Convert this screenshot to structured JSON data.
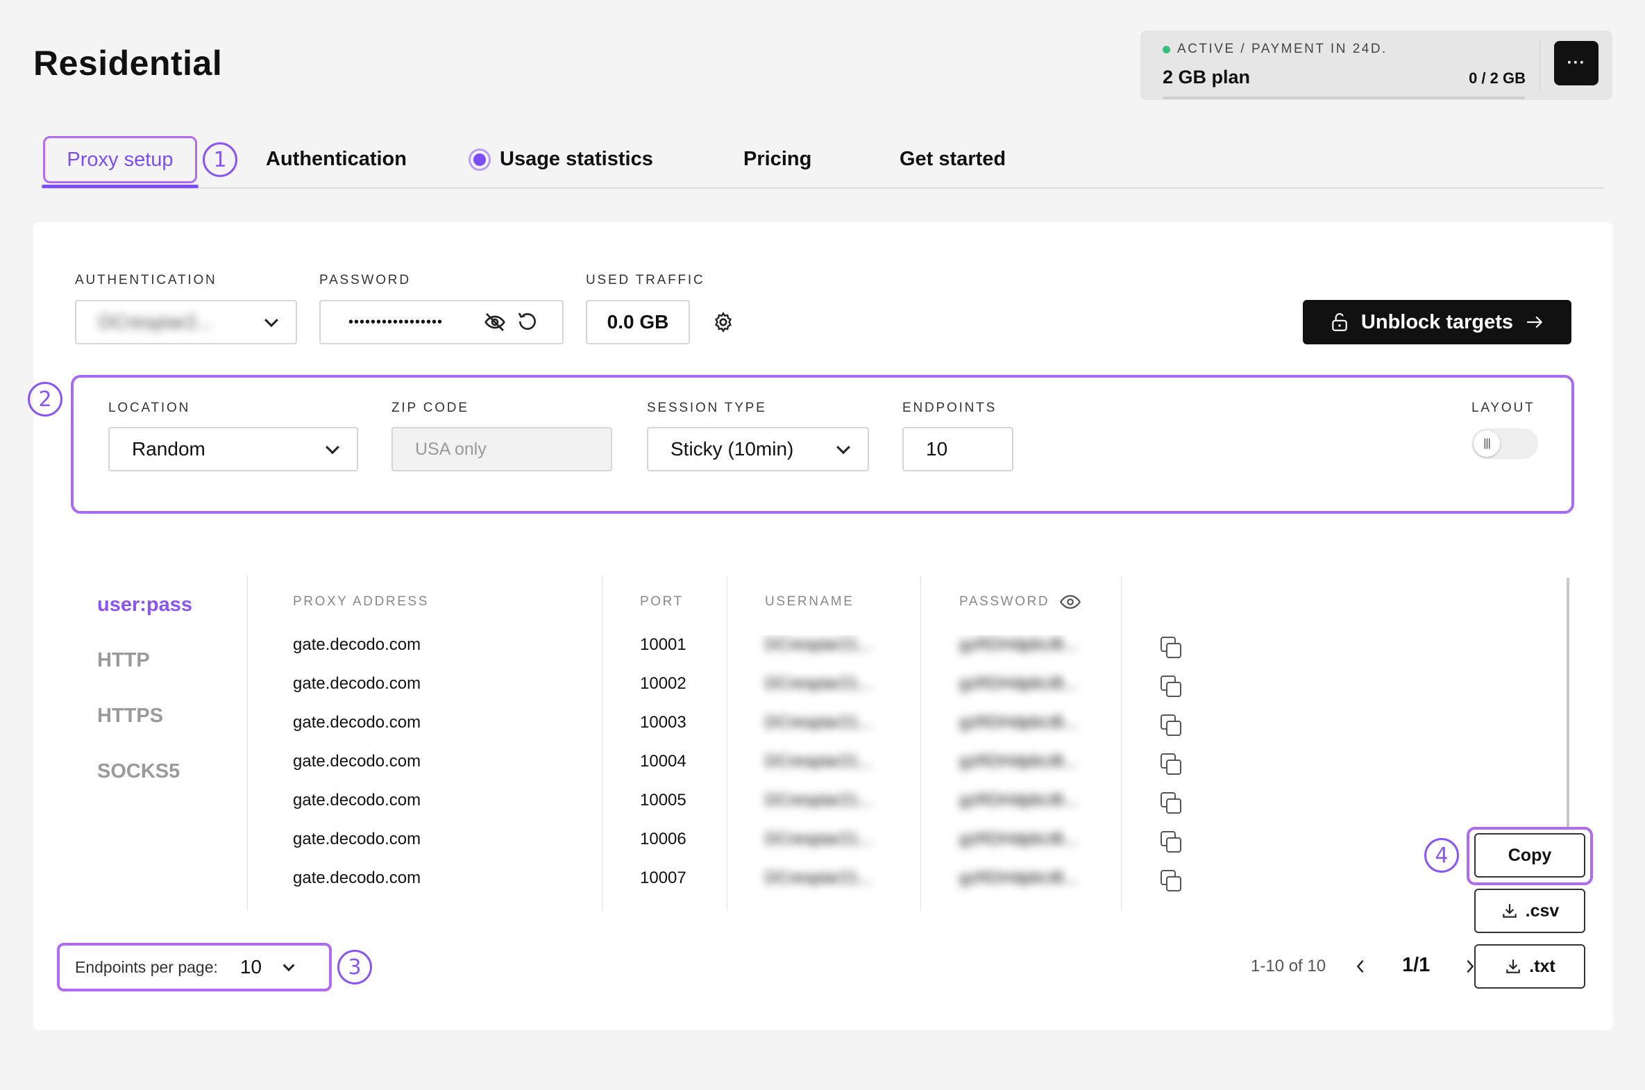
{
  "page": {
    "title": "Residential"
  },
  "plan": {
    "status": "ACTIVE / PAYMENT IN 24D.",
    "name": "2 GB plan",
    "usage": "0 / 2 GB",
    "more_label": "···",
    "status_color": "#34c07a",
    "used_fraction": 0
  },
  "tabs": [
    {
      "label": "Proxy setup",
      "active": true
    },
    {
      "label": "Authentication"
    },
    {
      "label": "Usage statistics"
    },
    {
      "label": "Pricing"
    },
    {
      "label": "Get started"
    }
  ],
  "badges": [
    "1",
    "2",
    "3",
    "4"
  ],
  "auth": {
    "auth_label": "AUTHENTICATION",
    "auth_value": "DCrespiar2...",
    "password_label": "PASSWORD",
    "password_value": "•••••••••••••••••",
    "traffic_label": "USED TRAFFIC",
    "traffic_value": "0.0 GB",
    "unblock_label": "Unblock targets"
  },
  "settings": {
    "location_label": "LOCATION",
    "location_value": "Random",
    "zip_label": "ZIP CODE",
    "zip_placeholder": "USA only",
    "session_label": "SESSION TYPE",
    "session_value": "Sticky (10min)",
    "endpoints_label": "ENDPOINTS",
    "endpoints_value": "10",
    "layout_label": "LAYOUT",
    "layout_glyph": "|||"
  },
  "protocols": [
    "user:pass",
    "HTTP",
    "HTTPS",
    "SOCKS5"
  ],
  "table": {
    "headers": [
      "PROXY ADDRESS",
      "PORT",
      "USERNAME",
      "PASSWORD"
    ],
    "rows": [
      {
        "address": "gate.decodo.com",
        "port": "10001",
        "username": "DCrespiar21...",
        "password": "gzRDHdpbUB..."
      },
      {
        "address": "gate.decodo.com",
        "port": "10002",
        "username": "DCrespiar21...",
        "password": "gzRDHdpbUB..."
      },
      {
        "address": "gate.decodo.com",
        "port": "10003",
        "username": "DCrespiar21...",
        "password": "gzRDHdpbUB..."
      },
      {
        "address": "gate.decodo.com",
        "port": "10004",
        "username": "DCrespiar21...",
        "password": "gzRDHdpbUB..."
      },
      {
        "address": "gate.decodo.com",
        "port": "10005",
        "username": "DCrespiar21...",
        "password": "gzRDHdpbUB..."
      },
      {
        "address": "gate.decodo.com",
        "port": "10006",
        "username": "DCrespiar21...",
        "password": "gzRDHdpbUB..."
      },
      {
        "address": "gate.decodo.com",
        "port": "10007",
        "username": "DCrespiar21...",
        "password": "gzRDHdpbUB..."
      }
    ]
  },
  "actions": {
    "copy": "Copy",
    "csv": ".csv",
    "txt": ".txt"
  },
  "footer": {
    "per_page_label": "Endpoints per page:",
    "per_page_value": "10",
    "range": "1-10 of 10",
    "page": "1/1"
  },
  "colors": {
    "accent": "#7b4dff",
    "highlight": "#b06bf0",
    "dark": "#111111"
  }
}
